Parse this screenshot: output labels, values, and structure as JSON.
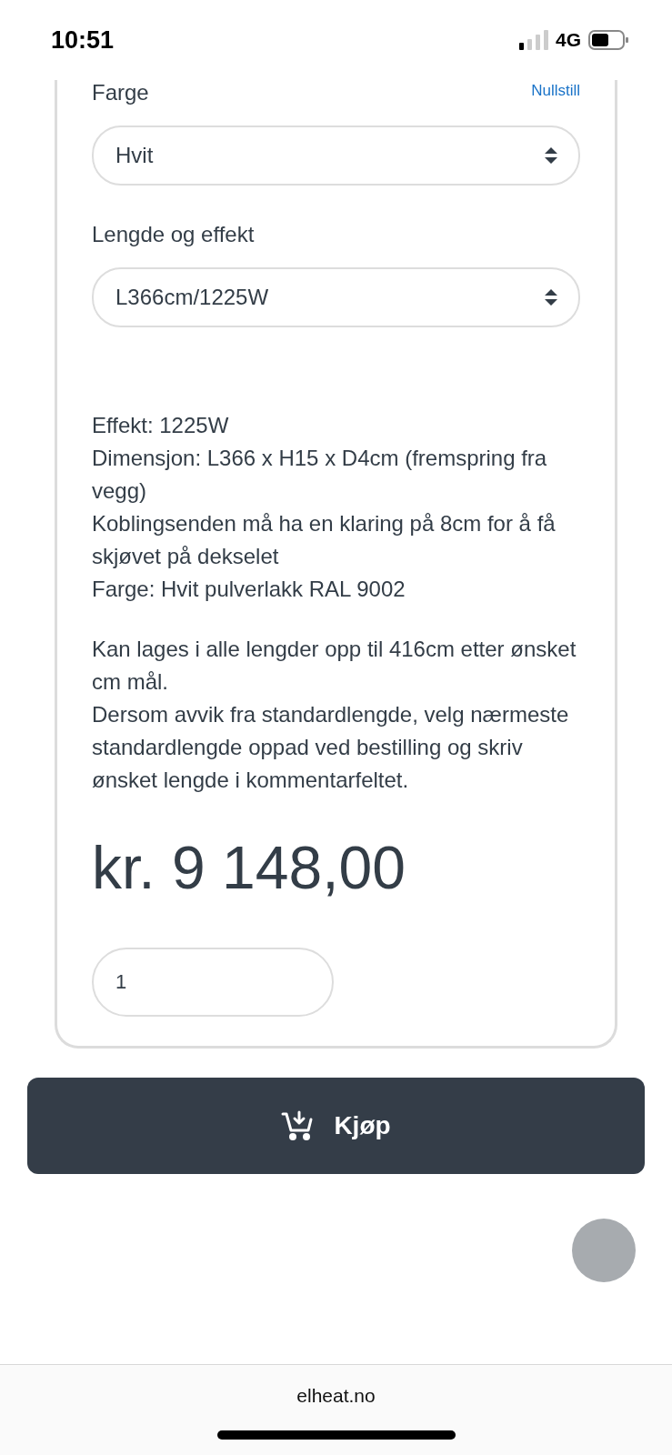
{
  "status_bar": {
    "time": "10:51",
    "network": "4G"
  },
  "fields": [
    {
      "label": "Farge",
      "reset_link": "Nullstill",
      "value": "Hvit"
    },
    {
      "label": "Lengde og effekt",
      "value": "L366cm/1225W"
    }
  ],
  "description": [
    [
      "Effekt: 1225W",
      "Dimensjon: L366 x H15 x D4cm (fremspring fra vegg)",
      "Koblingsenden må ha en klaring på 8cm for å få skjøvet på dekselet",
      "Farge: Hvit pulverlakk RAL 9002"
    ],
    [
      "Kan lages i alle lengder opp til 416cm etter ønsket cm mål.",
      "Dersom avvik fra standardlengde, velg nærmeste standardlengde oppad ved bestilling og skriv ønsket lengde i kommentarfeltet."
    ]
  ],
  "price": "kr. 9 148,00",
  "quantity": "1",
  "buy_button": "Kjøp",
  "url": "elheat.no"
}
